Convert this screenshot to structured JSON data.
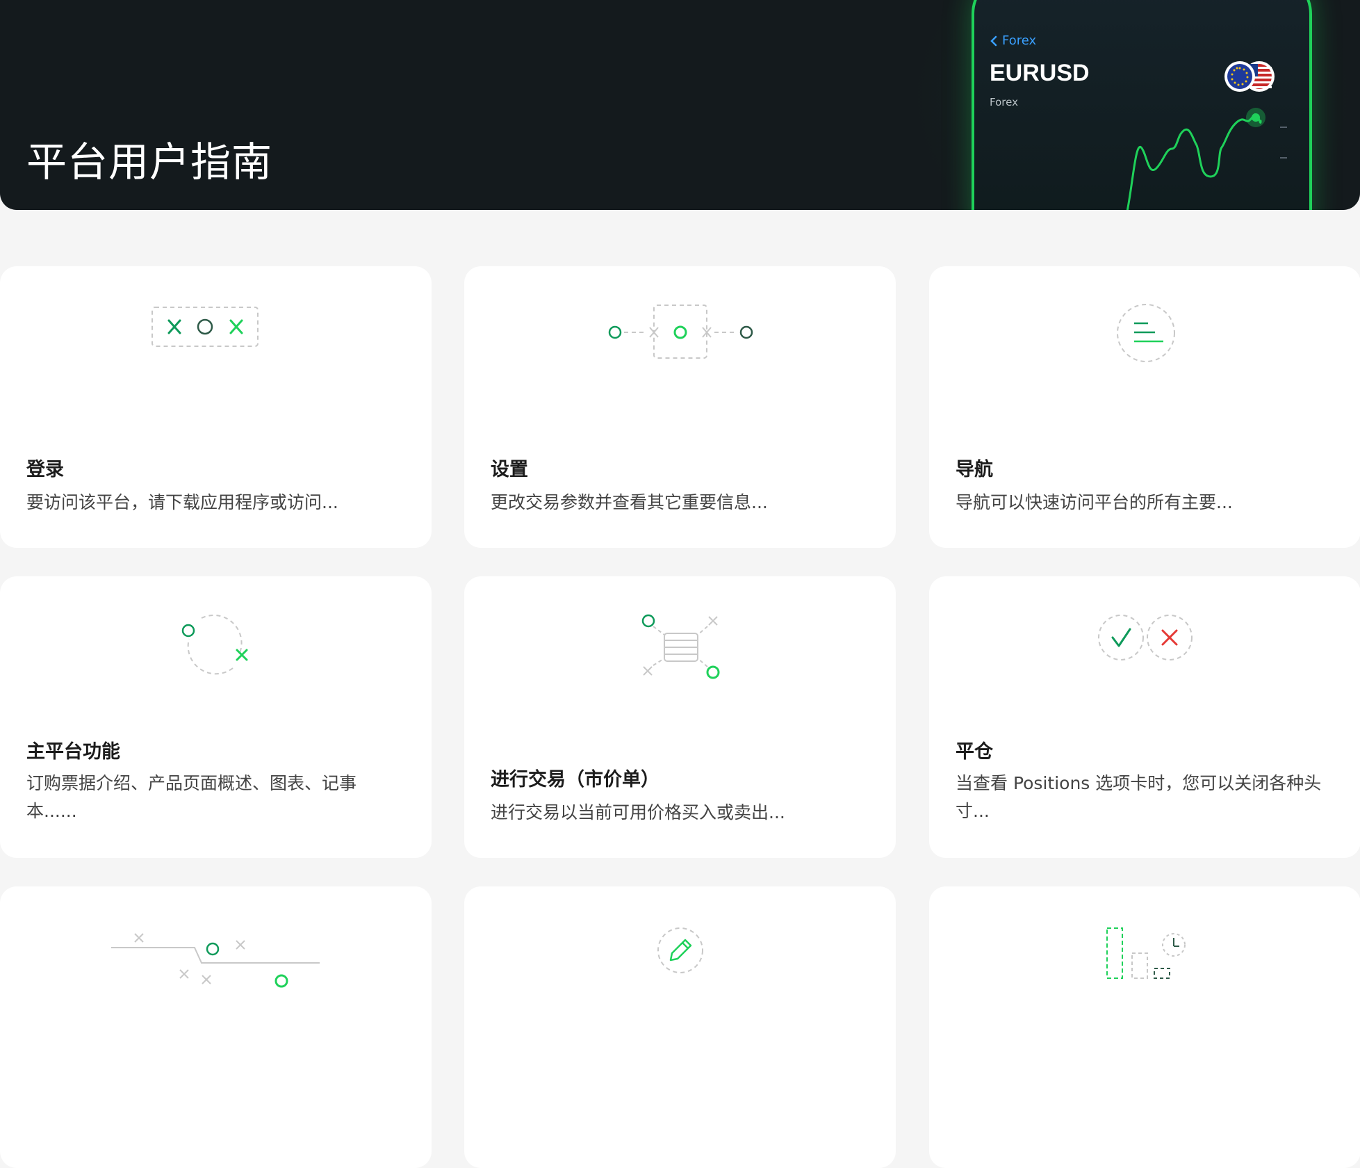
{
  "hero": {
    "title": "平台用户指南",
    "phone": {
      "back_label": "Forex",
      "symbol": "EURUSD",
      "category": "Forex"
    }
  },
  "colors": {
    "accent_green": "#1fd15a",
    "dark_green": "#0e7a4a",
    "red": "#e53935",
    "link_blue": "#3aa0ff"
  },
  "cards": [
    {
      "title": "登录",
      "desc": "要访问该平台，请下载应用程序或访问...",
      "icon": "login-illustration-icon"
    },
    {
      "title": "设置",
      "desc": "更改交易参数并查看其它重要信息...",
      "icon": "settings-illustration-icon"
    },
    {
      "title": "导航",
      "desc": "导航可以快速访问平台的所有主要...",
      "icon": "navigation-menu-icon"
    },
    {
      "title": "主平台功能",
      "desc": "订购票据介绍、产品页面概述、图表、记事本......",
      "icon": "platform-cycle-icon"
    },
    {
      "title": "进行交易（市价单）",
      "desc": "进行交易以当前可用价格买入或卖出...",
      "icon": "market-order-icon"
    },
    {
      "title": "平仓",
      "desc": "当查看 Positions 选项卡时，您可以关闭各种头寸...",
      "icon": "close-position-icon"
    },
    {
      "title": "",
      "desc": "",
      "icon": "pending-order-icon"
    },
    {
      "title": "",
      "desc": "",
      "icon": "edit-pencil-icon"
    },
    {
      "title": "",
      "desc": "",
      "icon": "chart-timer-icon"
    }
  ]
}
